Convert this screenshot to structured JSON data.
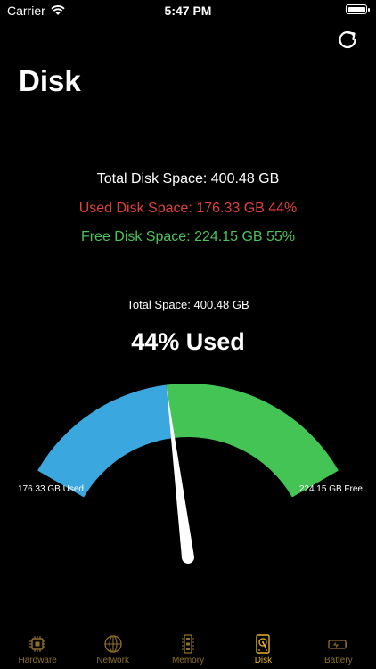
{
  "status": {
    "carrier": "Carrier",
    "time": "5:47 PM"
  },
  "page_title": "Disk",
  "info": {
    "total": "Total Disk Space: 400.48 GB",
    "used": "Used Disk Space: 176.33 GB 44%",
    "free": "Free Disk Space: 224.15 GB 55%"
  },
  "gauge": {
    "total_label": "Total Space: 400.48 GB",
    "percent_label": "44% Used",
    "used_label": "176.33 GB Used",
    "free_label": "224.15 GB Free",
    "used_fraction": 0.44
  },
  "colors": {
    "used_text": "#e0413a",
    "free_text": "#4cc25a",
    "used_arc": "#3aa7df",
    "free_arc": "#45c456",
    "tab_active": "#e2b12c",
    "tab_inactive": "#8f6f2b"
  },
  "tabs": [
    {
      "label": "Hardware",
      "icon": "chip-icon"
    },
    {
      "label": "Network",
      "icon": "globe-icon"
    },
    {
      "label": "Memory",
      "icon": "memory-icon"
    },
    {
      "label": "Disk",
      "icon": "disk-icon"
    },
    {
      "label": "Battery",
      "icon": "battery-icon"
    }
  ],
  "active_tab": "Disk"
}
